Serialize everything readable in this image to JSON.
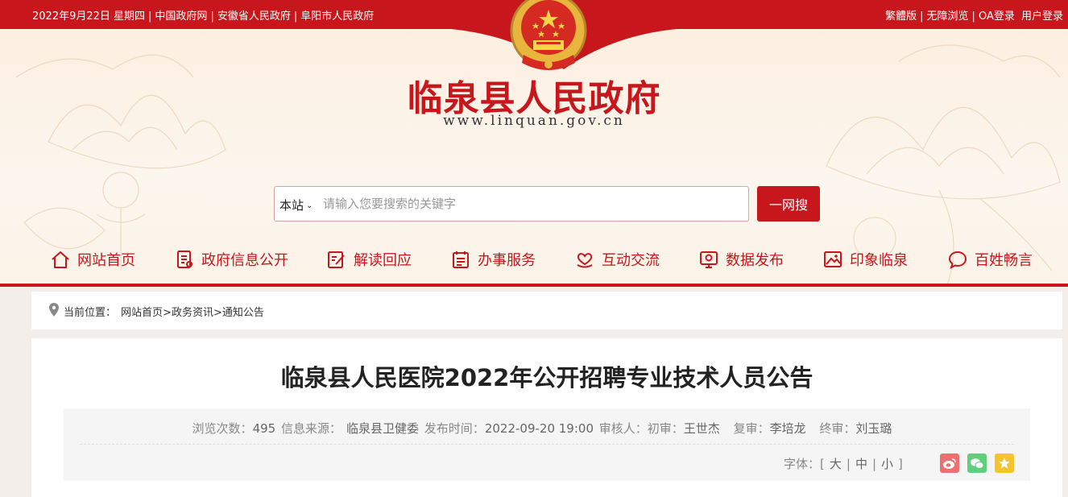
{
  "topbar": {
    "date": "2022年9月22日 星期四",
    "links": [
      "中国政府网",
      "安徽省人民政府",
      "阜阳市人民政府"
    ],
    "right_links": [
      "繁體版",
      "无障浏览",
      "OA登录",
      "用户登录"
    ]
  },
  "site": {
    "title": "临泉县人民政府",
    "url": "www.linquan.gov.cn"
  },
  "search": {
    "scope": "本站",
    "placeholder": "请输入您要搜索的关键字",
    "button": "一网搜"
  },
  "nav": [
    {
      "label": "网站首页",
      "icon": "home-icon"
    },
    {
      "label": "政府信息公开",
      "icon": "document-icon"
    },
    {
      "label": "解读回应",
      "icon": "edit-icon"
    },
    {
      "label": "办事服务",
      "icon": "calendar-icon"
    },
    {
      "label": "互动交流",
      "icon": "heart-hand-icon"
    },
    {
      "label": "数据发布",
      "icon": "monitor-icon"
    },
    {
      "label": "印象临泉",
      "icon": "image-icon"
    },
    {
      "label": "百姓畅言",
      "icon": "chat-icon"
    }
  ],
  "breadcrumb": {
    "prefix": "当前位置：",
    "items": [
      "网站首页",
      "政务资讯",
      "通知公告"
    ]
  },
  "article": {
    "title": "临泉县人民医院2022年公开招聘专业技术人员公告",
    "meta": {
      "views_label": "浏览次数：",
      "views": "495",
      "source_label": "信息来源：",
      "source": "临泉县卫健委",
      "time_label": "发布时间：",
      "time": "2022-09-20 19:00",
      "reviewer_label": "审核人：",
      "first_label": "初审：",
      "first": "王世杰",
      "second_label": "复审：",
      "second": "李培龙",
      "final_label": "终审：",
      "final": "刘玉璐"
    },
    "font": {
      "label": "字体：",
      "large": "大",
      "medium": "中",
      "small": "小"
    }
  },
  "colors": {
    "brand_red": "#c8161d",
    "weibo": "#ee6f6f",
    "wechat": "#5fcf7c",
    "favorite": "#f5c32c"
  }
}
